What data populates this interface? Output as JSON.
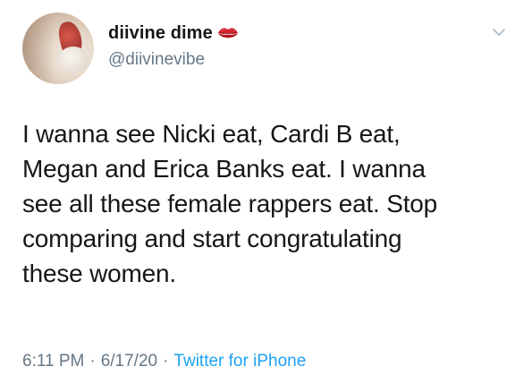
{
  "tweet": {
    "display_name": "diivine dime",
    "name_emoji_icon": "lips-kiss-icon",
    "handle": "@diivinevibe",
    "text_lines": [
      "I wanna see Nicki eat, Cardi B eat,",
      "Megan and Erica Banks eat. I wanna",
      "see all these female rappers eat. Stop",
      "comparing and start congratulating",
      "these women."
    ],
    "time": "6:11 PM",
    "date": "6/17/20",
    "separator": "·",
    "source": "Twitter for iPhone",
    "more_icon": "chevron-down-icon"
  },
  "colors": {
    "text_primary": "#14171a",
    "text_secondary": "#657786",
    "link": "#1da1f2",
    "background": "#ffffff"
  }
}
